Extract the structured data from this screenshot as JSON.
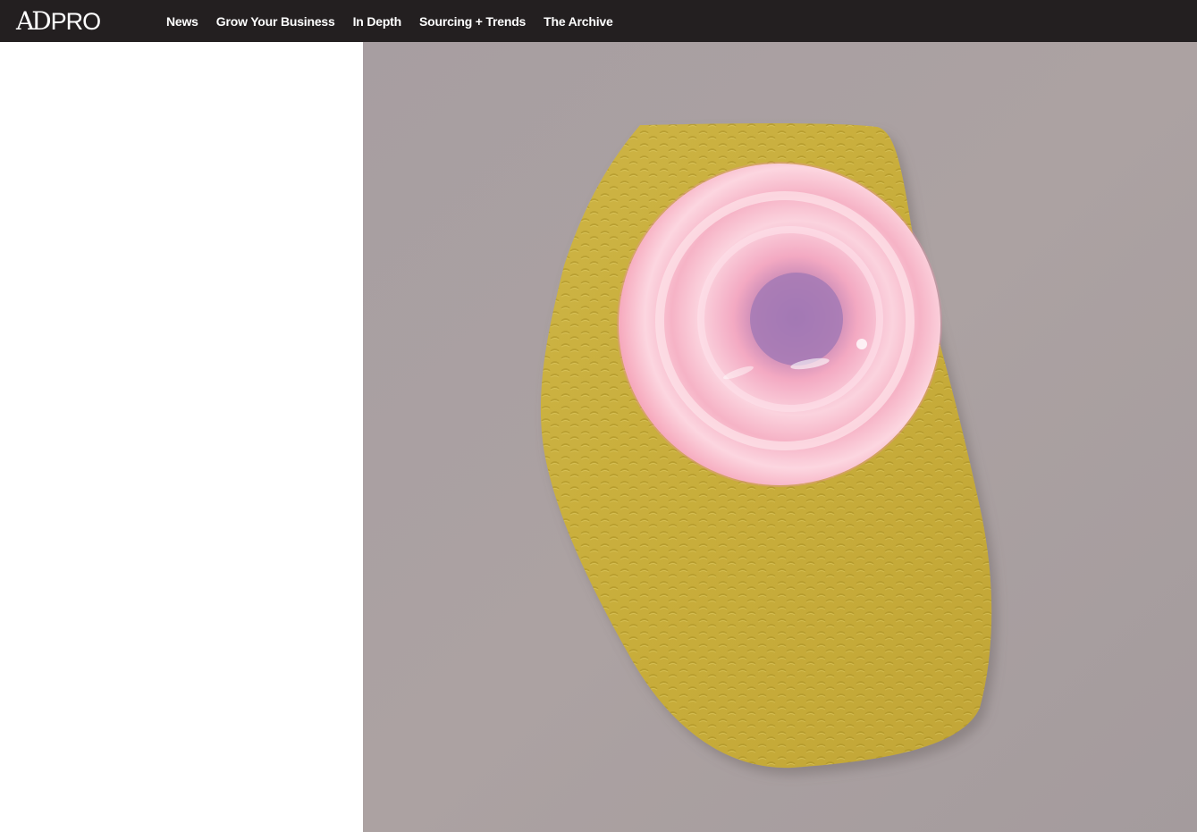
{
  "header": {
    "logo": {
      "part1": "AD",
      "part2": "PRO"
    },
    "nav": [
      {
        "label": "News"
      },
      {
        "label": "Grow Your Business"
      },
      {
        "label": "In Depth"
      },
      {
        "label": "Sourcing + Trends"
      },
      {
        "label": "The Archive"
      }
    ]
  },
  "colors": {
    "topbar": "#231f20",
    "wall": "#a9a0a2",
    "panel": "#c9b13c",
    "lamp": "#f7b8c8",
    "lamp_center": "#a678b0"
  }
}
